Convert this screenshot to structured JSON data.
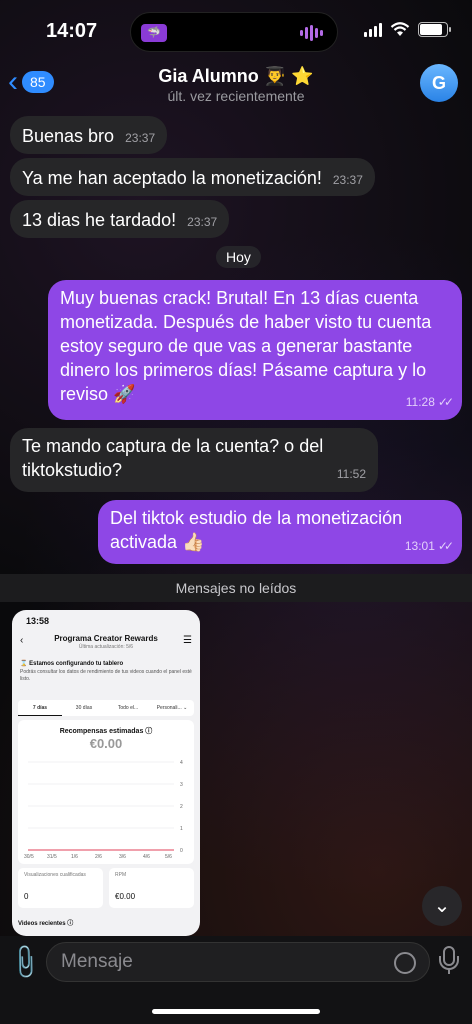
{
  "status_bar": {
    "time": "14:07",
    "island_app": "🦈"
  },
  "header": {
    "back_count": "85",
    "title": "Gia Alumno 👨‍🎓 ⭐",
    "subtitle": "últ. vez recientemente",
    "avatar_letter": "G"
  },
  "messages": [
    {
      "direction": "in",
      "text": "Buenas bro",
      "time": "23:37"
    },
    {
      "direction": "in",
      "text": "Ya me han aceptado la monetización!",
      "time": "23:37"
    },
    {
      "direction": "in",
      "text": "13 dias he tardado!",
      "time": "23:37"
    },
    {
      "direction": "out",
      "text": "Muy buenas crack! Brutal! En 13 días cuenta monetizada. Después de haber visto tu cuenta estoy seguro de que vas a generar bastante dinero los primeros días! Pásame captura y lo reviso 🚀",
      "time": "11:28"
    },
    {
      "direction": "in",
      "text": "Te mando captura de la cuenta? o del tiktokstudio?",
      "time": "11:52"
    },
    {
      "direction": "out",
      "text": "Del tiktok estudio de la monetización activada 👍🏻",
      "time": "13:01"
    }
  ],
  "date_separator": "Hoy",
  "unread_separator": "Mensajes no leídos",
  "screenshot": {
    "time": "13:58",
    "title": "Programa Creator Rewards",
    "subtitle": "Última actualización: 5/6",
    "setup_title": "⌛ Estamos configurando tu tablero",
    "setup_desc": "Podrás consultar los datos de rendimiento de tus videos cuando el panel esté listo.",
    "tabs": [
      "7 días",
      "30 días",
      "Todo el...",
      "Personali... ⌄"
    ],
    "rewards_label": "Recompensas estimadas ⓘ",
    "rewards_value": "€0.00",
    "chart_y_ticks": [
      "4",
      "3",
      "2",
      "1",
      "0"
    ],
    "chart_x_ticks": [
      "30/5",
      "31/5",
      "1/6",
      "2/6",
      "3/6",
      "4/6",
      "5/6"
    ],
    "tile_views_label": "Visualizaciones cualificadas",
    "tile_views_value": "0",
    "tile_rpm_label": "RPM",
    "tile_rpm_value": "€0.00",
    "videos_label": "Videos recientes ⓘ"
  },
  "input": {
    "placeholder": "Mensaje"
  },
  "colors": {
    "accent": "#2f8cff",
    "outgoing": "#8e47e6",
    "incoming": "#262628"
  }
}
